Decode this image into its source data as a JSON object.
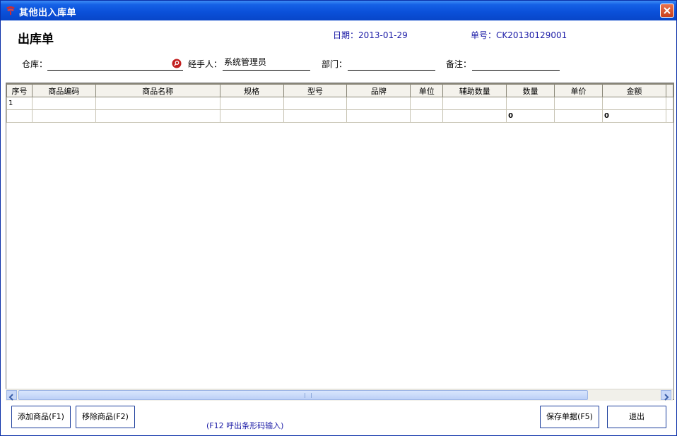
{
  "window": {
    "title": "其他出入库单"
  },
  "header": {
    "doc_title": "出库单",
    "date": "日期：2013-01-29",
    "number": "单号：CK20130129001"
  },
  "form": {
    "warehouse_label": "仓库：",
    "warehouse_value": "",
    "handler_label": "经手人：",
    "handler_value": "系统管理员",
    "dept_label": "部门：",
    "dept_value": "",
    "remark_label": "备注：",
    "remark_value": ""
  },
  "table": {
    "columns": [
      "序号",
      "商品编码",
      "商品名称",
      "规格",
      "型号",
      "品牌",
      "单位",
      "辅助数量",
      "数量",
      "单价",
      "金额"
    ],
    "row1": [
      "1",
      "",
      "",
      "",
      "",
      "",
      "",
      "",
      "",
      "",
      ""
    ],
    "summary": [
      "",
      "",
      "",
      "",
      "",
      "",
      "",
      "",
      "0",
      "",
      "0"
    ]
  },
  "footer": {
    "add_label": "添加商品(F1)",
    "remove_label": "移除商品(F2)",
    "hint": "(F12 呼出条形码输入)",
    "save_label": "保存单据(F5)",
    "exit_label": "退出"
  }
}
